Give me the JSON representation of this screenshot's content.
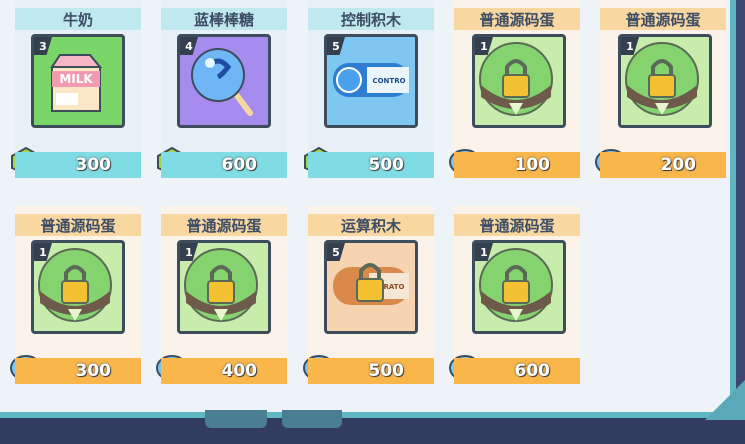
{
  "cards": [
    {
      "title": "牛奶",
      "level": "3",
      "price": "300",
      "currency": "gem-icon",
      "item": "milk-carton-icon"
    },
    {
      "title": "蓝棒棒糖",
      "level": "4",
      "price": "600",
      "currency": "gem-icon",
      "item": "lollipop-icon"
    },
    {
      "title": "控制积木",
      "level": "5",
      "price": "500",
      "currency": "gem-icon",
      "item": "control-block-icon"
    },
    {
      "title": "普通源码蛋",
      "level": "1",
      "price": "100",
      "currency": "crystal-icon",
      "item": "locked-egg-icon"
    },
    {
      "title": "普通源码蛋",
      "level": "1",
      "price": "200",
      "currency": "crystal-icon",
      "item": "locked-egg-icon"
    },
    {
      "title": "普通源码蛋",
      "level": "1",
      "price": "300",
      "currency": "crystal-icon",
      "item": "locked-egg-icon"
    },
    {
      "title": "普通源码蛋",
      "level": "1",
      "price": "400",
      "currency": "crystal-icon",
      "item": "locked-egg-icon"
    },
    {
      "title": "运算积木",
      "level": "5",
      "price": "500",
      "currency": "crystal-icon",
      "item": "operator-block-icon"
    },
    {
      "title": "普通源码蛋",
      "level": "1",
      "price": "600",
      "currency": "crystal-icon",
      "item": "locked-egg-icon"
    }
  ],
  "block_texts": {
    "control": "CONTRO",
    "operator": "PERATO"
  }
}
